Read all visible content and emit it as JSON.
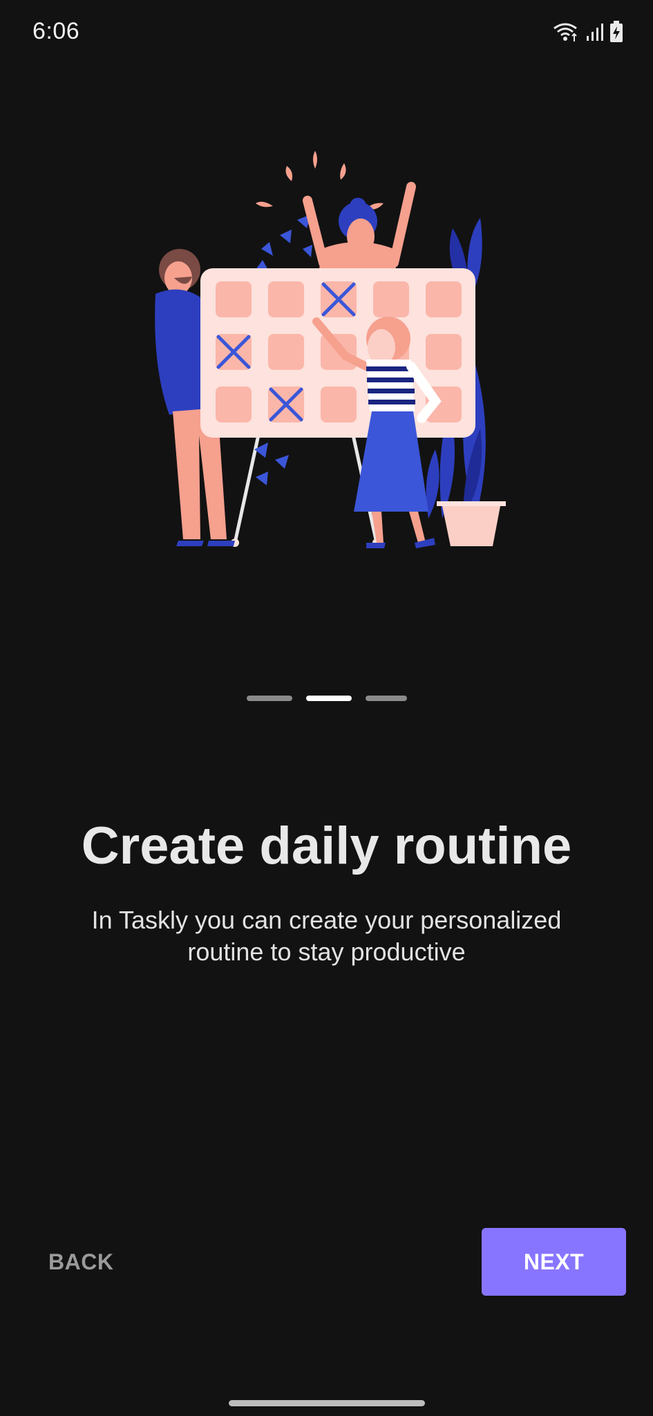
{
  "status_bar": {
    "time": "6:06",
    "icons": [
      "wifi-icon",
      "signal-icon",
      "battery-charging-icon"
    ]
  },
  "onboarding": {
    "illustration": "calendar-planning-illustration",
    "page_indicator": {
      "total": 3,
      "current": 2
    },
    "title": "Create daily routine",
    "description": "In Taskly you can create your personalized routine to stay productive"
  },
  "navigation": {
    "back_label": "BACK",
    "next_label": "NEXT"
  },
  "colors": {
    "background": "#121212",
    "accent": "#8875FF",
    "illustration_pink": "#F6A08E",
    "illustration_blue": "#2D3FBF"
  }
}
